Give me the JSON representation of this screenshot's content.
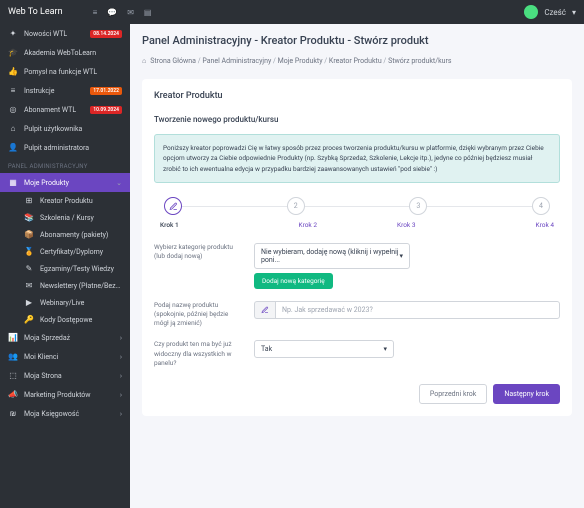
{
  "brand": "Web To Learn",
  "greeting": "Cześć",
  "sidebar": {
    "items": [
      {
        "icon": "✦",
        "label": "Nowości WTL",
        "badge": "08.14.2024",
        "badgeClass": "badge-red"
      },
      {
        "icon": "🎓",
        "label": "Akademia WebToLearn"
      },
      {
        "icon": "👍",
        "label": "Pomysł na funkcje WTL"
      },
      {
        "icon": "≡",
        "label": "Instrukcje",
        "badge": "17.01.2022",
        "badgeClass": "badge-orange"
      },
      {
        "icon": "◎",
        "label": "Abonament WTL",
        "badge": "10.09.2024",
        "badgeClass": "badge-red"
      },
      {
        "icon": "⌂",
        "label": "Pulpit użytkownika"
      },
      {
        "icon": "👤",
        "label": "Pulpit administratora"
      }
    ],
    "section": "PANEL ADMINISTRACYJNY",
    "active": {
      "icon": "▦",
      "label": "Moje Produkty"
    },
    "subs": [
      {
        "icon": "⊞",
        "label": "Kreator Produktu"
      },
      {
        "icon": "📚",
        "label": "Szkolenia / Kursy"
      },
      {
        "icon": "📦",
        "label": "Abonamenty (pakiety)"
      },
      {
        "icon": "🏅",
        "label": "Certyfikaty/Dyplomy"
      },
      {
        "icon": "✎",
        "label": "Egzaminy/Testy Wiedzy"
      },
      {
        "icon": "✉",
        "label": "Newslettery (Płatne/Bezpłatne)"
      },
      {
        "icon": "▶",
        "label": "Webinary/Live"
      },
      {
        "icon": "🔑",
        "label": "Kody Dostępowe"
      }
    ],
    "bottom": [
      {
        "icon": "📊",
        "label": "Moja Sprzedaż"
      },
      {
        "icon": "👥",
        "label": "Moi Klienci"
      },
      {
        "icon": "⬚",
        "label": "Moja Strona"
      },
      {
        "icon": "📣",
        "label": "Marketing Produktów"
      },
      {
        "icon": "₪",
        "label": "Moja Księgowość"
      }
    ]
  },
  "page": {
    "title": "Panel Administracyjny - Kreator Produktu - Stwórz produkt",
    "breadcrumb": [
      "Strona Główna",
      "Panel Administracyjny",
      "Moje Produkty",
      "Kreator Produktu",
      "Stwórz produkt/kurs"
    ]
  },
  "card": {
    "title": "Kreator Produktu",
    "section": "Tworzenie nowego produktu/kursu",
    "info": "Poniższy kreator poprowadzi Cię w łatwy sposób przez proces tworzenia produktu/kursu w platformie, dzięki wybranym przez Ciebie opcjom utworzy za Ciebie odpowiednie Produkty (np. Szybką Sprzedaż, Szkolenie, Lekcje itp.), jedyne co później będziesz musiał zrobić to ich ewentualna edycja w przypadku bardziej zaawansowanych ustawień \"pod siebie\" :)",
    "steps": [
      "Krok 1",
      "Krok 2",
      "Krok 3",
      "Krok 4"
    ],
    "stepNums": [
      "2",
      "3",
      "4"
    ],
    "form": {
      "catLabel": "Wybierz kategorię produktu (lub dodaj nową)",
      "catSelect": "Nie wybieram, dodaję nową (kliknij i wypełnij poni...",
      "catBtn": "Dodaj nową kategorię",
      "nameLabel": "Podaj nazwę produktu (spokojnie, później będzie mógł ją zmienić)",
      "namePlaceholder": "Np. Jak sprzedawać w 2023?",
      "visLabel": "Czy produkt ten ma być już widoczny dla wszystkich w panelu?",
      "visSelect": "Tak"
    },
    "prevBtn": "Poprzedni krok",
    "nextBtn": "Następny krok"
  }
}
